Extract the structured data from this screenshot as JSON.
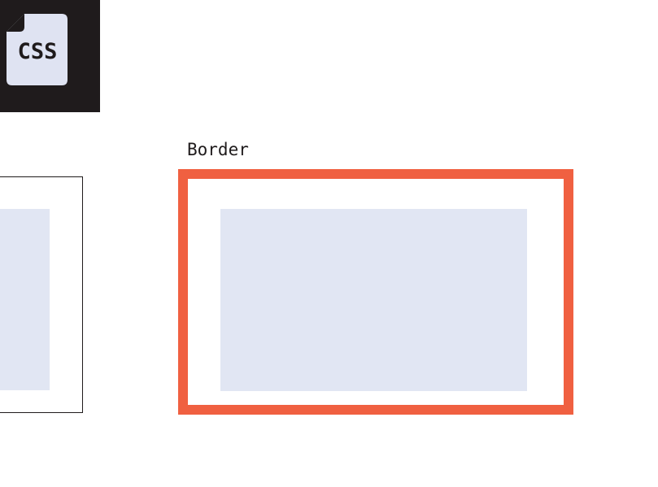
{
  "logo": {
    "text": "CSS",
    "icon": "css-file-icon",
    "tile_color": "#1f1b1c",
    "page_color": "#dfe3f2"
  },
  "diagram": {
    "border_label": "Border",
    "border_color": "#f06041",
    "content_color": "#e1e6f3",
    "outline_color": "#1f1b1c"
  }
}
